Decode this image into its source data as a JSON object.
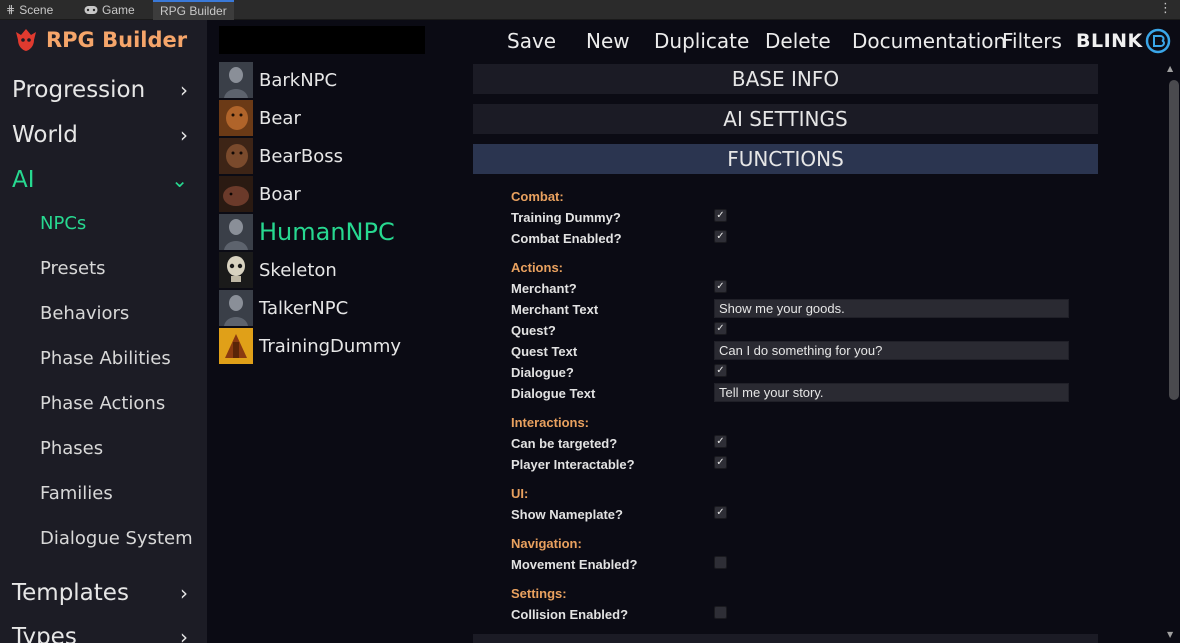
{
  "tabs": [
    {
      "label": "Scene",
      "icon": "grid-icon"
    },
    {
      "label": "Game",
      "icon": "gamepad-icon"
    },
    {
      "label": "RPG Builder",
      "icon": ""
    }
  ],
  "logo": {
    "text": "RPG Builder"
  },
  "sidebar": {
    "categories": [
      {
        "label": "Progression",
        "expanded": false
      },
      {
        "label": "World",
        "expanded": false
      },
      {
        "label": "AI",
        "expanded": true
      },
      {
        "label": "Templates",
        "expanded": false
      },
      {
        "label": "Types",
        "expanded": false
      }
    ],
    "ai_items": [
      "NPCs",
      "Presets",
      "Behaviors",
      "Phase Abilities",
      "Phase Actions",
      "Phases",
      "Families",
      "Dialogue System"
    ],
    "active_item": "NPCs"
  },
  "entries": [
    {
      "name": "BarkNPC"
    },
    {
      "name": "Bear"
    },
    {
      "name": "BearBoss"
    },
    {
      "name": "Boar"
    },
    {
      "name": "HumanNPC"
    },
    {
      "name": "Skeleton"
    },
    {
      "name": "TalkerNPC"
    },
    {
      "name": "TrainingDummy"
    }
  ],
  "toolbar": {
    "save": "Save",
    "new": "New",
    "duplicate": "Duplicate",
    "delete": "Delete",
    "documentation": "Documentation",
    "filters": "Filters",
    "brand": "BLINK"
  },
  "sections": {
    "base_info": "BASE INFO",
    "ai_settings": "AI SETTINGS",
    "functions": "FUNCTIONS"
  },
  "functions": {
    "combat": {
      "title": "Combat:",
      "training_dummy": {
        "label": "Training Dummy?",
        "checked": true
      },
      "combat_enabled": {
        "label": "Combat Enabled?",
        "checked": true
      }
    },
    "actions": {
      "title": "Actions:",
      "merchant": {
        "label": "Merchant?",
        "checked": true
      },
      "merchant_text": {
        "label": "Merchant Text",
        "value": "Show me your goods."
      },
      "quest": {
        "label": "Quest?",
        "checked": true
      },
      "quest_text": {
        "label": "Quest Text",
        "value": "Can I do something for you?"
      },
      "dialogue": {
        "label": "Dialogue?",
        "checked": true
      },
      "dialogue_text": {
        "label": "Dialogue Text",
        "value": "Tell me your story."
      }
    },
    "interactions": {
      "title": "Interactions:",
      "can_be_targeted": {
        "label": "Can be targeted?",
        "checked": true
      },
      "player_interactable": {
        "label": "Player Interactable?",
        "checked": true
      }
    },
    "ui": {
      "title": "UI:",
      "show_nameplate": {
        "label": "Show Nameplate?",
        "checked": true
      }
    },
    "navigation": {
      "title": "Navigation:",
      "movement_enabled": {
        "label": "Movement Enabled?",
        "checked": false
      }
    },
    "settings": {
      "title": "Settings:",
      "collision_enabled": {
        "label": "Collision Enabled?",
        "checked": false
      }
    }
  },
  "colors": {
    "accent_green": "#27d890",
    "group_orange": "#e9a15f",
    "logo_orange": "#f5a56a",
    "logo_red": "#e03a2f",
    "active_section": "#2b3550"
  }
}
